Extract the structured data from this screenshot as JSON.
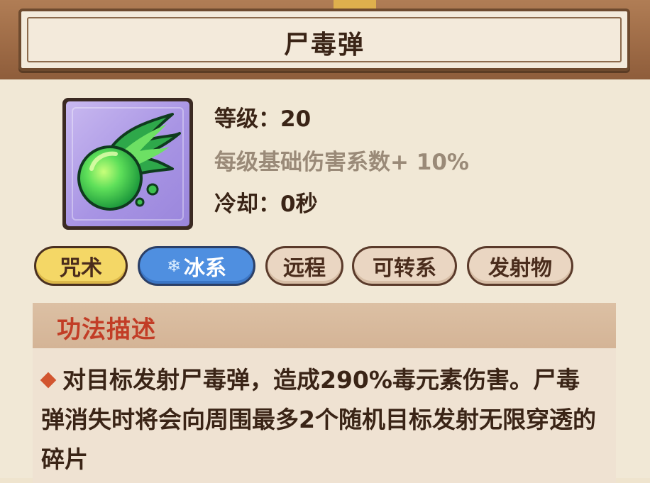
{
  "skill": {
    "name": "尸毒弹",
    "icon": "green-poison-fireball-icon",
    "level_line": "等级：20",
    "bonus_line": "每级基础伤害系数+ 10%",
    "cooldown_line": "冷却：0秒"
  },
  "tags": [
    {
      "label": "咒术",
      "style": "yellow"
    },
    {
      "label": "冰系",
      "style": "blue",
      "icon": "snowflake-icon"
    },
    {
      "label": "远程",
      "style": "tan"
    },
    {
      "label": "可转系",
      "style": "tan"
    },
    {
      "label": "发射物",
      "style": "tan"
    }
  ],
  "description": {
    "header": "功法描述",
    "text": "对目标发射尸毒弹，造成290%毒元素伤害。尸毒弹消失时将会向周围最多2个随机目标发射无限穿透的碎片"
  },
  "colors": {
    "title_text": "#3a2416",
    "bonus_text": "#9a8a78",
    "desc_header_text": "#c23d26",
    "tag_yellow": "#f4d766",
    "tag_blue": "#4f8fe0",
    "tag_tan": "#ead6c2"
  }
}
